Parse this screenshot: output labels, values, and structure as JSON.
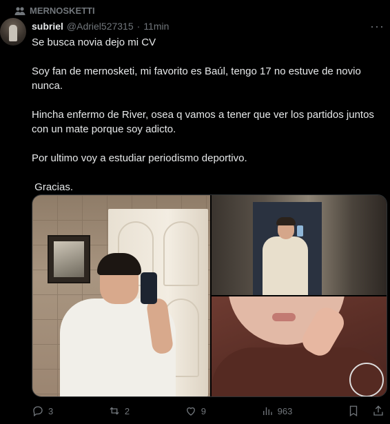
{
  "community": {
    "name": "MERNOSKETTI",
    "icon": "people-icon"
  },
  "post": {
    "author_name": "subriel",
    "handle": "@Adriel527315",
    "separator": "·",
    "time": "11min",
    "more_icon": "more-horizontal-icon",
    "paragraphs": [
      "Se busca novia dejo mi CV",
      "Soy fan de mernosketi, mi favorito es Baúl, tengo 17 no estuve de novio nunca.",
      "Hincha enfermo de River, osea q vamos a tener que ver los partidos juntos con un mate porque soy adicto.",
      "Por ultimo voy a estudiar periodismo deportivo.",
      " Gracias."
    ],
    "media_count": 3
  },
  "actions": {
    "replies": "3",
    "reposts": "2",
    "likes": "9",
    "views": "963",
    "icons": [
      "reply-icon",
      "repost-icon",
      "like-icon",
      "views-icon",
      "bookmark-icon",
      "share-icon"
    ]
  },
  "colors": {
    "background": "#000000",
    "text": "#e7e9ea",
    "muted": "#71767b",
    "border": "#2f3336"
  }
}
